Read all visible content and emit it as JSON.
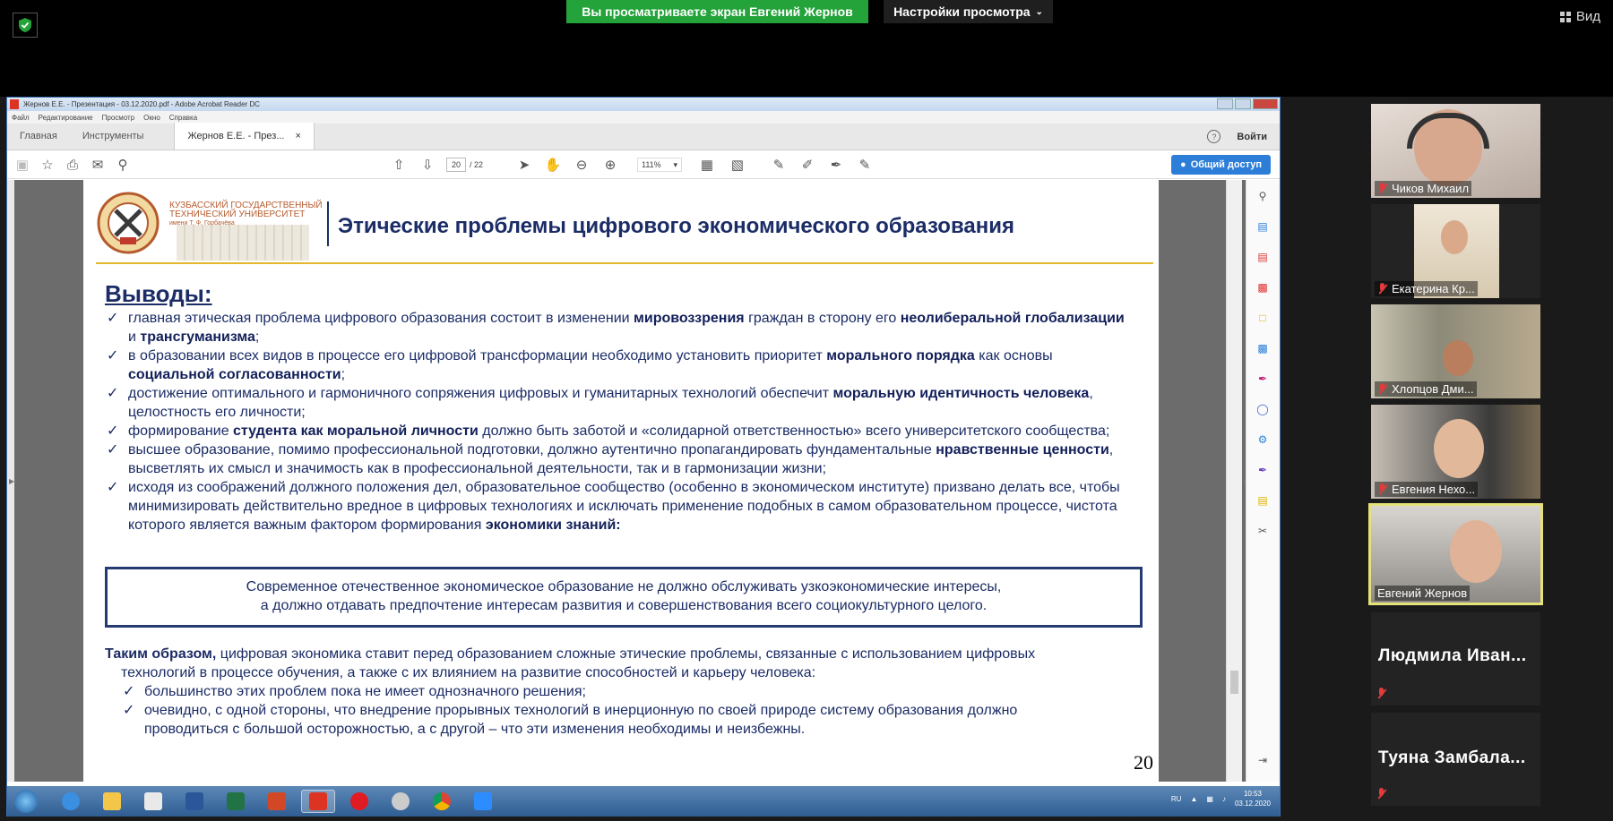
{
  "zoom": {
    "viewing_banner": "Вы просматриваете экран Евгений Жернов",
    "view_settings": "Настройки просмотра",
    "view_button": "Вид"
  },
  "acrobat": {
    "window_title": "Жернов Е.Е. - Презентация - 03.12.2020.pdf - Adobe Acrobat Reader DC",
    "menu": [
      "Файл",
      "Редактирование",
      "Просмотр",
      "Окно",
      "Справка"
    ],
    "tabs": {
      "home": "Главная",
      "tools": "Инструменты",
      "document": "Жернов Е.Е. - През..."
    },
    "sign_in": "Войти",
    "current_page": "20",
    "total_pages": "/ 22",
    "zoom_level": "111%",
    "share_button": "Общий доступ"
  },
  "slide": {
    "university_line1": "КУЗБАССКИЙ ГОСУДАРСТВЕННЫЙ",
    "university_line2": "ТЕХНИЧЕСКИЙ УНИВЕРСИТЕТ",
    "university_line3": "имени Т. Ф. Горбачёва",
    "title": "Этические проблемы цифрового экономического образования",
    "conclusions_heading": "Выводы:",
    "bullets": [
      [
        "главная этическая проблема цифрового образования состоит в изменении ",
        "мировоззрения",
        " граждан в сторону его ",
        "неолиберальной глобализации",
        " и ",
        "трансгуманизма",
        ";"
      ],
      [
        "в образовании всех видов в процессе его цифровой трансформации необходимо установить приоритет ",
        "морального порядка",
        " как основы ",
        "социальной согласованности",
        ";"
      ],
      [
        "достижение оптимального и гармоничного сопряжения цифровых и гуманитарных технологий обеспечит ",
        "моральную идентичность человека",
        ", целостность его личности;"
      ],
      [
        "формирование ",
        "студента как моральной личности",
        " должно быть заботой и «солидарной ответственностью» всего университетского сообщества;"
      ],
      [
        "высшее образование, помимо профессиональной подготовки, должно аутентично пропагандировать фундаментальные ",
        "нравственные ценности",
        ", высветлять их смысл и значимость как в профессиональной деятельности, так и в гармонизации жизни;"
      ],
      [
        "исходя из соображений должного положения дел, образовательное сообщество (особенно в экономическом институте) призвано делать все, чтобы минимизировать действительно вредное в цифровых технологиях и исключать применение подобных в самом образовательном процессе, чистота которого является важным фактором формирования ",
        "экономики знаний:"
      ]
    ],
    "quote_line1": "Современное отечественное экономическое образование не должно обслуживать узкоэкономические интересы,",
    "quote_line2": "а должно отдавать предпочтение интересам развития и совершенствования всего социокультурного целого.",
    "summary_bold": "Таким образом,",
    "summary_text1": " цифровая экономика ставит перед образованием сложные этические проблемы, связанные с использованием цифровых",
    "summary_text2": "технологий в процессе обучения, а также с их влиянием на развитие способностей и карьеру человека:",
    "summary_bullet1": "большинство этих проблем пока не имеет однозначного решения;",
    "summary_bullet2_line1": "очевидно, с одной стороны, что внедрение прорывных технологий в инерционную по своей природе систему образования должно",
    "summary_bullet2_line2": "проводиться с большой осторожностью, а с другой –  что эти изменения необходимы и неизбежны.",
    "page_number": "20"
  },
  "taskbar": {
    "language": "RU",
    "time": "10:53",
    "date": "03.12.2020"
  },
  "participants": [
    {
      "name": "Чиков Михаил",
      "muted": true
    },
    {
      "name": "Екатерина Кр...",
      "muted": true
    },
    {
      "name": "Хлопцов Дми...",
      "muted": true
    },
    {
      "name": "Евгения Нехо...",
      "muted": true
    },
    {
      "name": "Евгений Жернов",
      "muted": false,
      "speaking": true
    },
    {
      "name": "Людмила  Иван...",
      "muted": true,
      "video": false
    },
    {
      "name": "Туяна  Замбала...",
      "muted": true,
      "video": false
    }
  ],
  "colors": {
    "zoom_green": "#23a33a",
    "slide_navy": "#1b2c66",
    "accent_gold": "#e3b72e",
    "acrobat_blue": "#2d7ed8"
  }
}
